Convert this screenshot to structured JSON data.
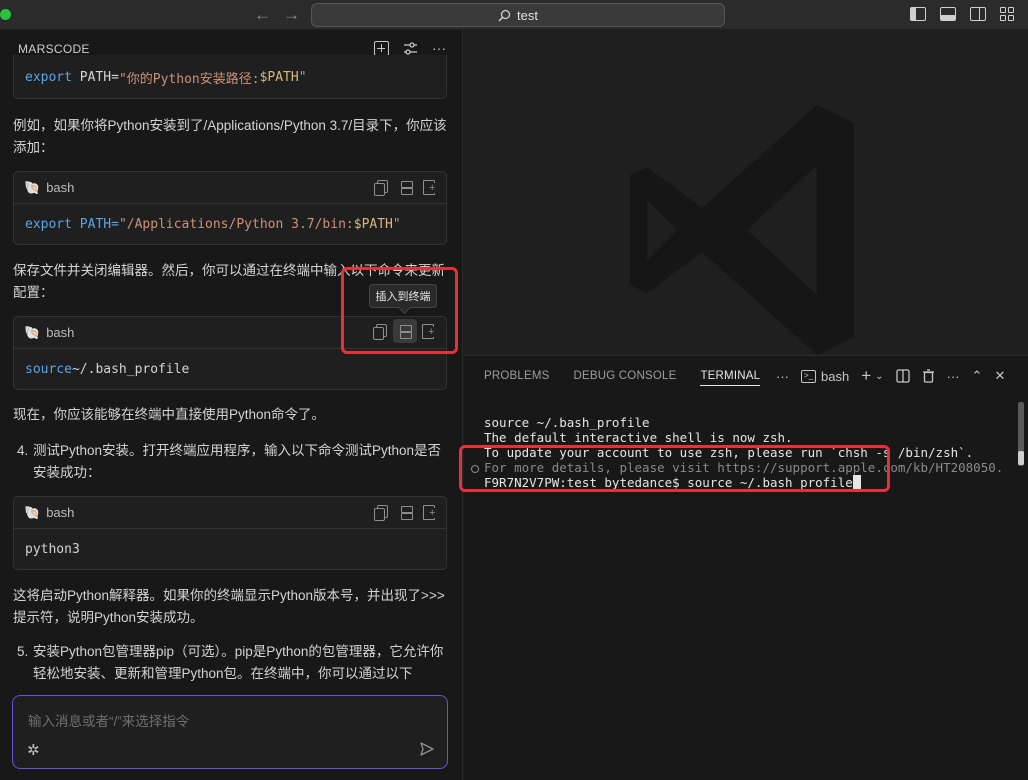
{
  "titlebar": {
    "search_text": "test"
  },
  "chat": {
    "header_title": "MARSCODE",
    "code1": {
      "keyword": "export",
      "var_name": "PATH=",
      "string": "\"你的Python安装路径:",
      "var_ref": "$PATH",
      "close": "\""
    },
    "para1": "例如，如果你将Python安装到了/Applications/Python 3.7/目录下，你应该添加：",
    "code2": {
      "lang": "bash",
      "keyword": "export",
      "var_name": "PATH=",
      "string": "\"/Applications/Python 3.7/bin:",
      "var_ref": "$PATH",
      "close": "\""
    },
    "para2": "保存文件并关闭编辑器。然后，你可以通过在终端中输入以下命令来更新配置：",
    "tooltip": "插入到终端",
    "code3": {
      "lang": "bash",
      "keyword": "source",
      "rest": " ~/.bash_profile"
    },
    "para3": "现在，你应该能够在终端中直接使用Python命令了。",
    "item4": {
      "num": "4.",
      "text": "测试Python安装。打开终端应用程序，输入以下命令测试Python是否安装成功："
    },
    "code4": {
      "lang": "bash",
      "content": "python3"
    },
    "para4": "这将启动Python解释器。如果你的终端显示Python版本号，并出现了>>>提示符，说明Python安装成功。",
    "item5": {
      "num": "5.",
      "text": "安装Python包管理器pip（可选）。pip是Python的包管理器，它允许你轻松地安装、更新和管理Python包。在终端中，你可以通过以下"
    },
    "input_placeholder": "输入消息或者“/”来选择指令"
  },
  "panel": {
    "tabs": [
      "PROBLEMS",
      "DEBUG CONSOLE",
      "TERMINAL"
    ],
    "active_tab": "TERMINAL",
    "shell_label": "bash",
    "terminal_lines": [
      "source ~/.bash_profile",
      "The default interactive shell is now zsh.",
      "To update your account to use zsh, please run `chsh -s /bin/zsh`.",
      "For more details, please visit https://support.apple.com/kb/HT208050."
    ],
    "prompt": "F9R7N2V7PW:test bytedance$ source ~/.bash_profile"
  },
  "colors": {
    "accent": "#6e4fd6",
    "highlight_red": "#e5323a",
    "traffic_green": "#29c13f"
  }
}
